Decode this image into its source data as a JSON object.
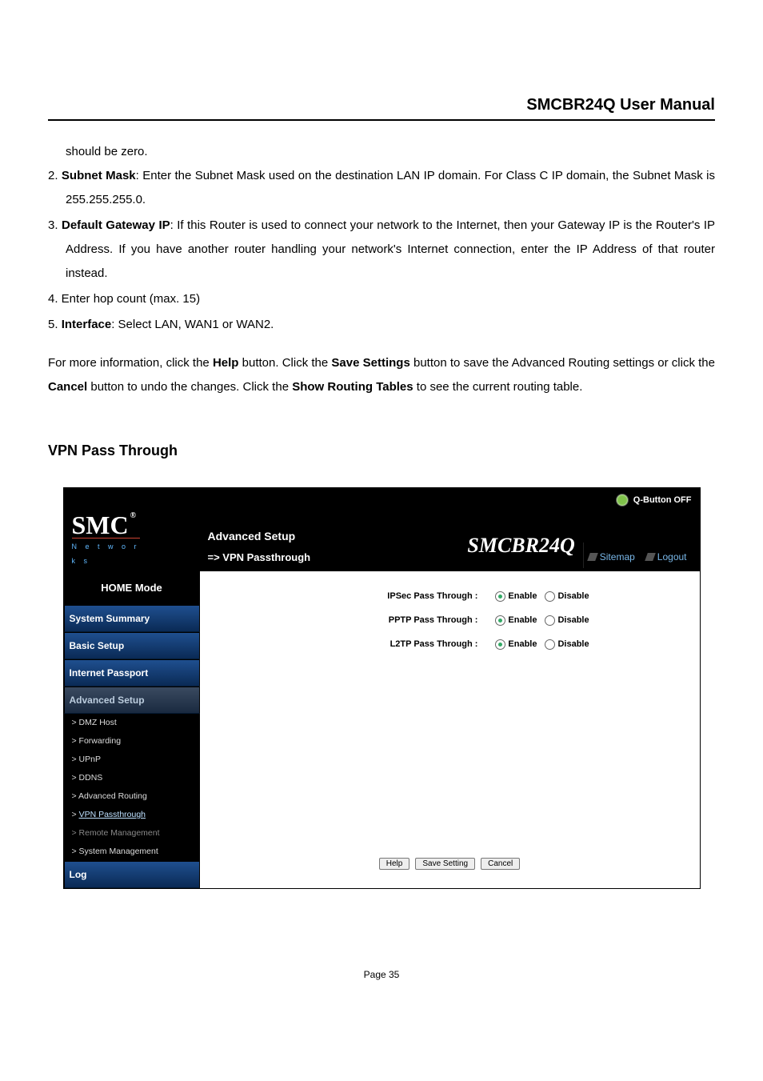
{
  "header": {
    "title": "SMCBR24Q User Manual"
  },
  "intro_tail": "should be zero.",
  "list": {
    "i2_num": "2. ",
    "i2_b": "Subnet Mask",
    "i2_a": ": Enter the Subnet Mask used on the destination LAN IP domain. For Class C IP domain, the Subnet Mask is 255.255.255.0.",
    "i3_num": "3. ",
    "i3_b": "Default Gateway IP",
    "i3_a": ": If this Router is used to connect your network to the Internet, then your Gateway IP is the Router's IP Address. If you have another router handling your network's Internet connection, enter the IP Address of that router instead.",
    "i4": "4. Enter hop count (max. 15)",
    "i5_num": "5. ",
    "i5_b": "Interface",
    "i5_a": ": Select LAN, WAN1 or WAN2."
  },
  "para": {
    "p1a": "For more information, click the ",
    "p1b1": "Help",
    "p1c": " button. Click the ",
    "p1b2": "Save Settings",
    "p1d": " button to save the Advanced Routing settings or click the ",
    "p1b3": "Cancel",
    "p1e": " button to undo the changes. Click the ",
    "p1b4": "Show Routing Tables",
    "p1f": " to see the current routing table."
  },
  "section": "VPN Pass Through",
  "shot": {
    "qbutton": "Q-Button OFF",
    "logo_main": "SMC",
    "logo_reg": "®",
    "logo_sub": "N e t w o r k s",
    "bc1": "Advanced Setup",
    "bc2": "=> VPN Passthrough",
    "model": "SMCBR24Q",
    "sitemap": "Sitemap",
    "logout": "Logout",
    "sb": {
      "home": "HOME Mode",
      "summary": "System Summary",
      "basic": "Basic Setup",
      "passport": "Internet Passport",
      "adv": "Advanced Setup",
      "dmz": "> DMZ Host",
      "fwd": "> Forwarding",
      "upnp": "> UPnP",
      "ddns": "> DDNS",
      "arout": "> Advanced Routing",
      "vpn_pre": "> ",
      "vpn": "VPN Passthrough",
      "remote": "> Remote Management",
      "sysmgmt": "> System Management",
      "log": "Log"
    },
    "opts": {
      "ipsec": "IPSec Pass Through :",
      "pptp": "PPTP Pass Through :",
      "l2tp": "L2TP Pass Through :",
      "enable": "Enable",
      "disable": "Disable"
    },
    "btns": {
      "help": "Help",
      "save": "Save Setting",
      "cancel": "Cancel"
    }
  },
  "footer": "Page 35"
}
